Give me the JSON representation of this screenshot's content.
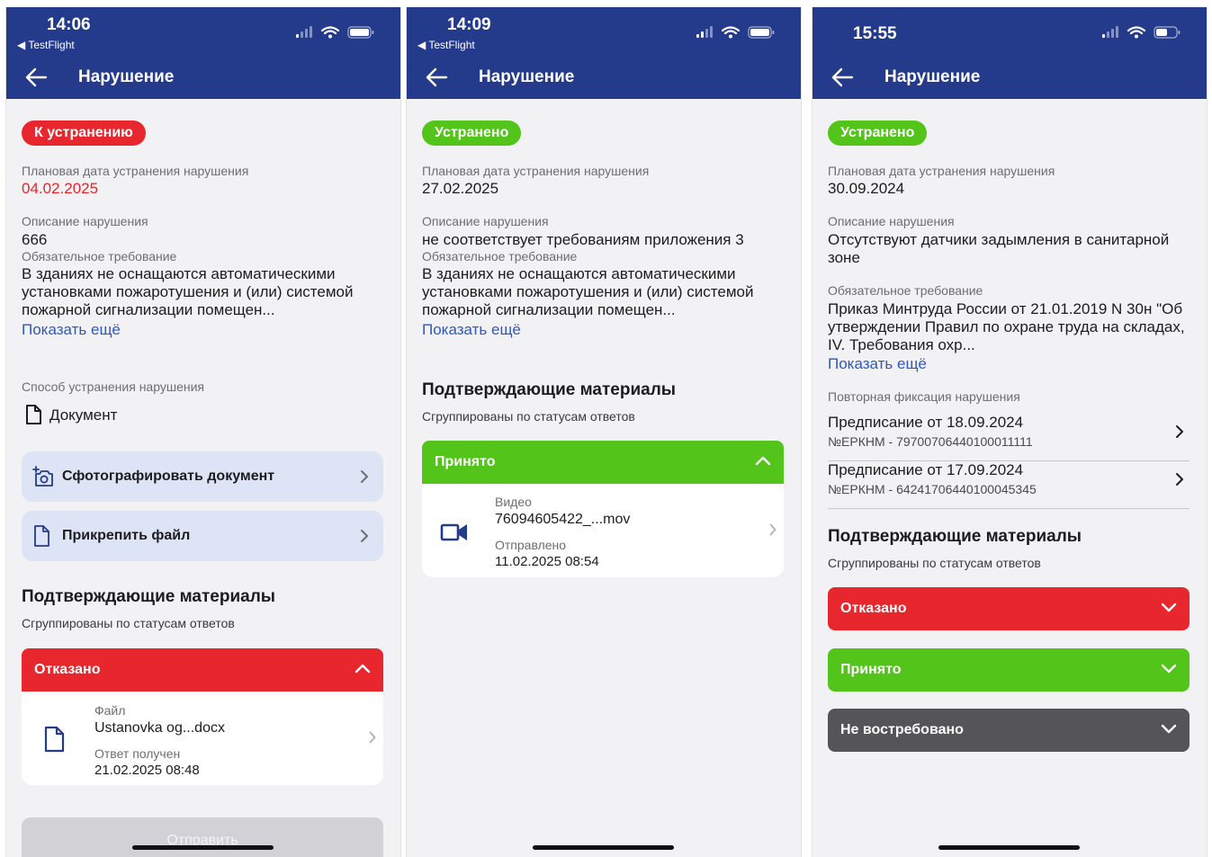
{
  "colors": {
    "appbar": "#243b8c",
    "red": "#e8262e",
    "green": "#52c41a",
    "gray": "#555558",
    "link": "#2f58c4"
  },
  "icons": [
    "back-arrow-icon",
    "signal-icon",
    "wifi-icon",
    "battery-icon",
    "document-icon",
    "camera-add-icon",
    "chevron-right-icon",
    "chevron-up-icon",
    "chevron-down-icon",
    "video-icon"
  ],
  "screens": [
    {
      "time": "14:06",
      "back_app": "◀ TestFlight",
      "title": "Нарушение",
      "status_badge": "К устранению",
      "planned_date_label": "Плановая дата устранения нарушения",
      "planned_date": "04.02.2025",
      "description_label": "Описание нарушения",
      "description": "666",
      "requirement_label": "Обязательное требование",
      "requirement": "В зданиях не оснащаются автоматическими установками пожаротушения и (или) системой пожарной сигнализации помещен...",
      "show_more": "Показать ещё",
      "method_label": "Способ устранения нарушения",
      "method_value": "Документ",
      "action_photo": "Сфотографировать документ",
      "action_attach": "Прикрепить файл",
      "materials_title": "Подтверждающие материалы",
      "materials_sub": "Сгруппированы по статусам ответов",
      "group_label": "Отказано",
      "item": {
        "type": "Файл",
        "name": "Ustanovka og...docx",
        "status_label": "Ответ получен",
        "date": "21.02.2025 08:48"
      },
      "send_button": "Отправить"
    },
    {
      "time": "14:09",
      "back_app": "◀ TestFlight",
      "title": "Нарушение",
      "status_badge": "Устранено",
      "planned_date_label": "Плановая дата устранения нарушения",
      "planned_date": "27.02.2025",
      "description_label": "Описание нарушения",
      "description": "не соответствует требованиям приложения 3",
      "requirement_label": "Обязательное требование",
      "requirement": "В зданиях не оснащаются автоматическими установками пожаротушения и (или) системой пожарной сигнализации помещен...",
      "show_more": "Показать ещё",
      "materials_title": "Подтверждающие материалы",
      "materials_sub": "Сгруппированы по статусам ответов",
      "group_label": "Принято",
      "item": {
        "type": "Видео",
        "name": "76094605422_...mov",
        "status_label": "Отправлено",
        "date": "11.02.2025 08:54"
      }
    },
    {
      "time": "15:55",
      "title": "Нарушение",
      "status_badge": "Устранено",
      "planned_date_label": "Плановая дата устранения нарушения",
      "planned_date": "30.09.2024",
      "description_label": "Описание нарушения",
      "description": "Отсутствуют датчики задымления в санитарной зоне",
      "requirement_label": "Обязательное требование",
      "requirement": "Приказ Минтруда России от 21.01.2019 N 30н \"Об утверждении Правил по охране труда на складах, IV. Требования охр...",
      "show_more": "Показать ещё",
      "repeat_label": "Повторная фиксация нарушения",
      "prescriptions": [
        {
          "title": "Предписание от 18.09.2024",
          "number": "№ЕРКНМ - 79700706440100011111"
        },
        {
          "title": "Предписание от 17.09.2024",
          "number": "№ЕРКНМ - 64241706440100045345"
        }
      ],
      "materials_title": "Подтверждающие материалы",
      "materials_sub": "Сгруппированы по статусам ответов",
      "groups": [
        "Отказано",
        "Принято",
        "Не востребовано"
      ]
    }
  ]
}
